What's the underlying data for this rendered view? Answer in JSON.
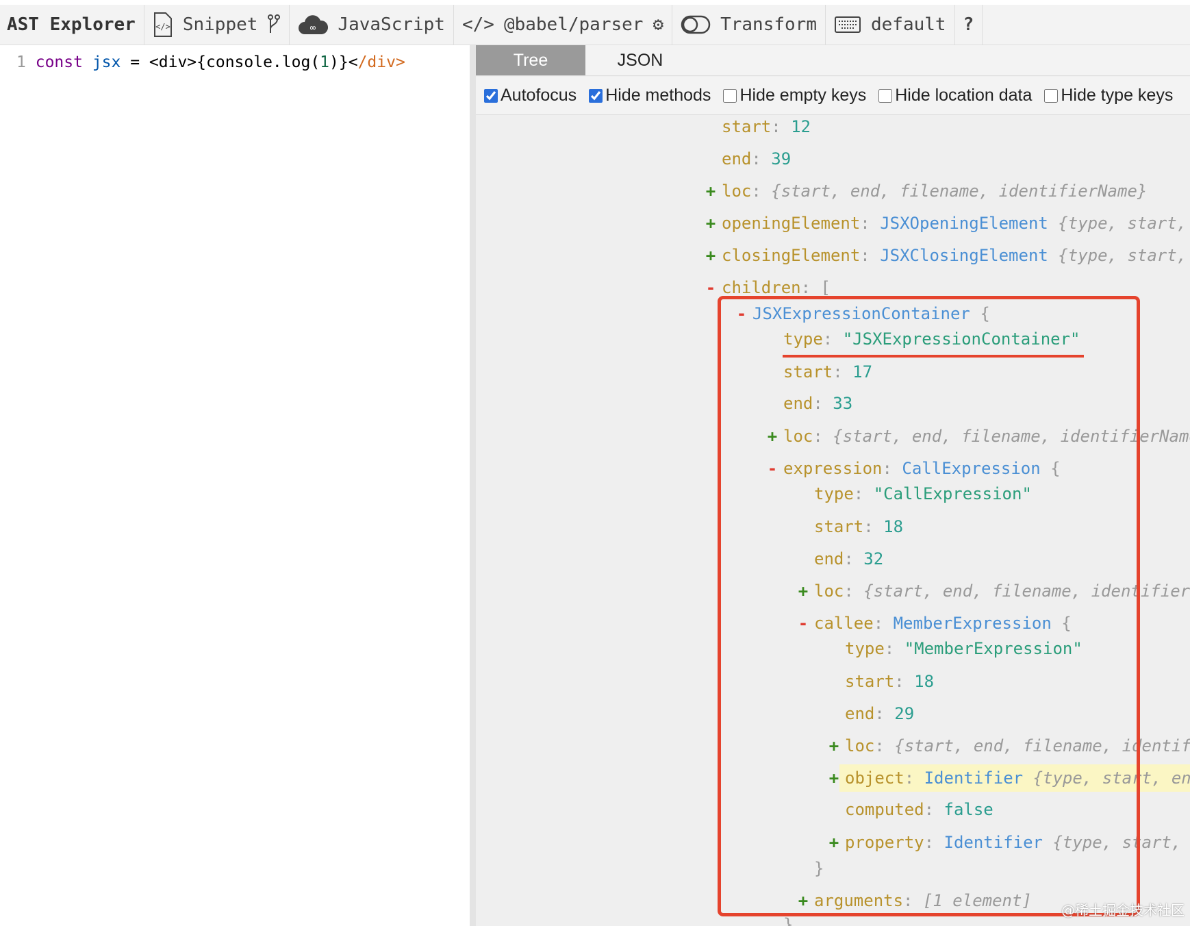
{
  "toolbar": {
    "title": "AST Explorer",
    "snippet": "Snippet",
    "language": "JavaScript",
    "parser": "@babel/parser",
    "transform": "Transform",
    "keymap": "default",
    "help": "?"
  },
  "editor": {
    "line_number": "1",
    "code": {
      "kw": "const",
      "var": "jsx",
      "op": " = ",
      "open": "<div>{console.log(",
      "num": "1",
      "close": ")}<",
      "tag": "/div>"
    }
  },
  "tabs": [
    {
      "label": "Tree",
      "active": true
    },
    {
      "label": "JSON",
      "active": false
    }
  ],
  "options": [
    {
      "label": "Autofocus",
      "checked": true
    },
    {
      "label": "Hide methods",
      "checked": true
    },
    {
      "label": "Hide empty keys",
      "checked": false
    },
    {
      "label": "Hide location data",
      "checked": false
    },
    {
      "label": "Hide type keys",
      "checked": false
    }
  ],
  "tree": [
    {
      "level": 0,
      "key": "start",
      "value": "12",
      "kind": "num"
    },
    {
      "level": 0,
      "key": "end",
      "value": "39",
      "kind": "num"
    },
    {
      "level": 0,
      "sign": "+",
      "key": "loc",
      "summary": "{start, end, filename, identifierName}"
    },
    {
      "level": 0,
      "sign": "+",
      "key": "openingElement",
      "value": "JSXOpeningElement",
      "kind": "type",
      "summary": "{type, start, end, loc}"
    },
    {
      "level": 0,
      "sign": "+",
      "key": "closingElement",
      "value": "JSXClosingElement",
      "kind": "type",
      "summary": "{type, start, end, loc}"
    },
    {
      "level": 0,
      "sign": "-",
      "key": "children",
      "bracket": " ["
    },
    {
      "level": 1,
      "sign": "-",
      "value": "JSXExpressionContainer",
      "kind": "type",
      "bracket": " {"
    },
    {
      "level": 2,
      "key": "type",
      "value": "\"JSXExpressionContainer\"",
      "kind": "str"
    },
    {
      "level": 2,
      "key": "start",
      "value": "17",
      "kind": "num"
    },
    {
      "level": 2,
      "key": "end",
      "value": "33",
      "kind": "num"
    },
    {
      "level": 2,
      "sign": "+",
      "key": "loc",
      "summary": "{start, end, filename, identifierName}"
    },
    {
      "level": 2,
      "sign": "-",
      "key": "expression",
      "value": "CallExpression",
      "kind": "type",
      "bracket": " {"
    },
    {
      "level": 3,
      "key": "type",
      "value": "\"CallExpression\"",
      "kind": "str"
    },
    {
      "level": 3,
      "key": "start",
      "value": "18",
      "kind": "num"
    },
    {
      "level": 3,
      "key": "end",
      "value": "32",
      "kind": "num"
    },
    {
      "level": 3,
      "sign": "+",
      "key": "loc",
      "summary": "{start, end, filename, identifierName}"
    },
    {
      "level": 3,
      "sign": "-",
      "key": "callee",
      "value": "MemberExpression",
      "kind": "type",
      "bracket": " {"
    },
    {
      "level": 4,
      "key": "type",
      "value": "\"MemberExpression\"",
      "kind": "str"
    },
    {
      "level": 4,
      "key": "start",
      "value": "18",
      "kind": "num"
    },
    {
      "level": 4,
      "key": "end",
      "value": "29",
      "kind": "num"
    },
    {
      "level": 4,
      "sign": "+",
      "key": "loc",
      "summary": "{start, end, filename, identifierName}"
    },
    {
      "level": 4,
      "sign": "+",
      "key": "object",
      "value": "Identifier",
      "kind": "type",
      "summary": "{type, start, end, loc, name}",
      "highlight": true
    },
    {
      "level": 4,
      "key": "computed",
      "value": "false",
      "kind": "bool"
    },
    {
      "level": 4,
      "sign": "+",
      "key": "property",
      "value": "Identifier",
      "kind": "type",
      "summary": "{type, start, end, loc, name}"
    },
    {
      "level": 3,
      "bracket": "}"
    },
    {
      "level": 3,
      "sign": "+",
      "key": "arguments",
      "summary": "[1 element]"
    },
    {
      "level": 2,
      "bracket": "}"
    }
  ],
  "watermark": "@稀土掘金技术社区"
}
